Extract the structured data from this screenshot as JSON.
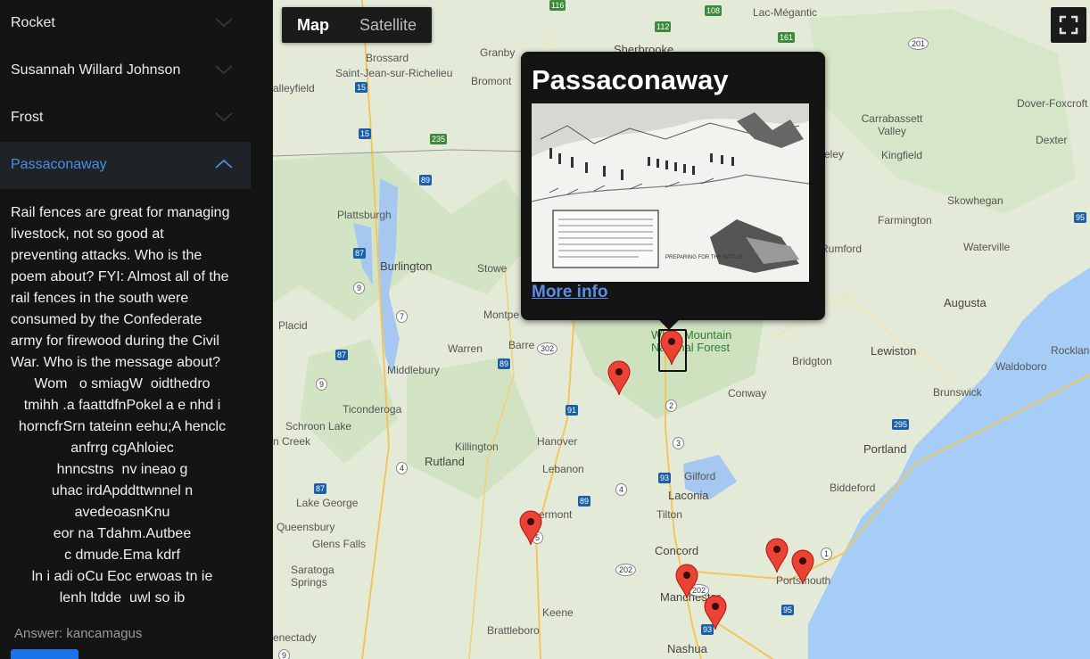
{
  "sidebar": {
    "items": [
      {
        "label": "Rocket"
      },
      {
        "label": "Susannah Willard Johnson"
      },
      {
        "label": "Frost"
      },
      {
        "label": "Passaconaway"
      }
    ],
    "active_index": 3,
    "description": "Rail fences are great for managing livestock, not so good at preventing attacks. Who is the poem about? FYI: Almost all of the rail fences in the south were consumed by the Confederate army for firewood during the Civil War. Who is the message about?",
    "puzzle_lines": [
      "Wom   o smiagW  oidthedro",
      "tmihh .a faattdfnPokel a e nhd i",
      "horncfrSrn tateinn eehu;A henclc",
      "anfrrg cgAhloiec",
      "hnncstns  nv ineao g",
      "uhac irdApddttwnnel n",
      "avedeoasnKnu",
      "eor na Tdahm.Autbee",
      "c dmude.Ema kdrf",
      "ln i adi oCu Eoc erwoas tn ie",
      "lenh ltdde  uwl so ib"
    ],
    "answer_text": "Answer: kancamagus"
  },
  "map": {
    "type_control": {
      "map_label": "Map",
      "satellite_label": "Satellite",
      "selected": "Map"
    },
    "fullscreen_icon": "fullscreen-icon",
    "places": [
      {
        "name": "Brossard"
      },
      {
        "name": "Saint-Jean-sur-Richelieu"
      },
      {
        "name": "Granby"
      },
      {
        "name": "Bromont"
      },
      {
        "name": "Sherbrooke"
      },
      {
        "name": "Lac-Mégantic"
      },
      {
        "name": "alleyfield"
      },
      {
        "name": "Plattsburgh"
      },
      {
        "name": "Burlington"
      },
      {
        "name": "Stowe"
      },
      {
        "name": "Montpe"
      },
      {
        "name": "Barre"
      },
      {
        "name": "Warren"
      },
      {
        "name": "Middlebury"
      },
      {
        "name": "Ticonderoga"
      },
      {
        "name": "Schroon Lake"
      },
      {
        "name": "n Creek"
      },
      {
        "name": "Killington"
      },
      {
        "name": "Rutland"
      },
      {
        "name": "Hanover"
      },
      {
        "name": "Lebanon"
      },
      {
        "name": "Lake George"
      },
      {
        "name": "Queensbury"
      },
      {
        "name": "Glens Falls"
      },
      {
        "name": "Saratoga Springs"
      },
      {
        "name": "Brattleboro"
      },
      {
        "name": "Keene"
      },
      {
        "name": "enectady"
      },
      {
        "name": "Concord"
      },
      {
        "name": "Manchester"
      },
      {
        "name": "Nashua"
      },
      {
        "name": "Laconia"
      },
      {
        "name": "Tilton"
      },
      {
        "name": "Gilford"
      },
      {
        "name": "Conway"
      },
      {
        "name": "Bridgton"
      },
      {
        "name": "Lewiston"
      },
      {
        "name": "Brunswick"
      },
      {
        "name": "Portland"
      },
      {
        "name": "Biddeford"
      },
      {
        "name": "Portsmouth"
      },
      {
        "name": "Augusta"
      },
      {
        "name": "Waterville"
      },
      {
        "name": "Skowhegan"
      },
      {
        "name": "Farmington"
      },
      {
        "name": "Kingfield"
      },
      {
        "name": "Carrabassett Valley"
      },
      {
        "name": "Dover-Foxcroft"
      },
      {
        "name": "Dexter"
      },
      {
        "name": "Waldoboro"
      },
      {
        "name": "Rockland"
      },
      {
        "name": "Rumford"
      },
      {
        "name": "eley"
      },
      {
        "name": "Placid"
      },
      {
        "name": "ermont"
      }
    ],
    "park_label": "White Mountain National Forest",
    "shields": [
      "116",
      "108",
      "112",
      "161",
      "201",
      "15",
      "15",
      "235",
      "89",
      "87",
      "9",
      "7",
      "87",
      "89",
      "302",
      "91",
      "4",
      "3",
      "93",
      "4",
      "89",
      "87",
      "9",
      "202",
      "93",
      "95",
      "1",
      "202",
      "2",
      "16",
      "295",
      "95",
      "5",
      "9"
    ],
    "info_window": {
      "title": "Passaconaway",
      "link_text": "More info",
      "image_caption": "PREPARING FOR THE BATTLE"
    },
    "markers": [
      {
        "name": "passaconaway",
        "selected": true
      },
      {
        "name": "frost"
      },
      {
        "name": "marker-west"
      },
      {
        "name": "marker-concord"
      },
      {
        "name": "marker-manchester"
      },
      {
        "name": "marker-portsmouth-a"
      },
      {
        "name": "marker-portsmouth-b"
      }
    ]
  }
}
